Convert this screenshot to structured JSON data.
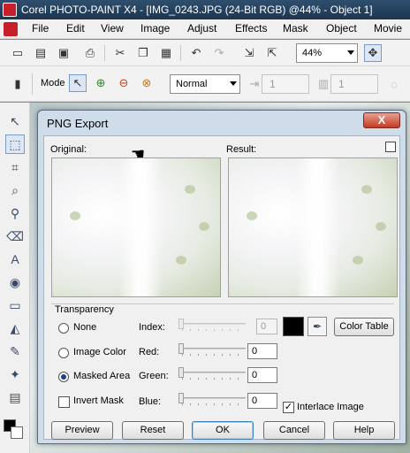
{
  "window": {
    "title": "Corel PHOTO-PAINT X4 - [IMG_0243.JPG (24-Bit RGB) @44% - Object 1]"
  },
  "menu": {
    "items": [
      "File",
      "Edit",
      "View",
      "Image",
      "Adjust",
      "Effects",
      "Mask",
      "Object",
      "Movie"
    ]
  },
  "toolbar": {
    "zoom_value": "44%"
  },
  "property_bar": {
    "mode_label": "Mode",
    "merge_mode_value": "Normal",
    "spin1_value": "1",
    "spin2_value": "1"
  },
  "dialog": {
    "title": "PNG Export",
    "close_label": "X",
    "original_label": "Original:",
    "result_label": "Result:",
    "transparency_label": "Transparency",
    "options": {
      "none": "None",
      "image_color": "Image Color",
      "masked_area": "Masked Area",
      "invert_mask": "Invert Mask",
      "selected": "masked_area"
    },
    "fields": {
      "index_label": "Index:",
      "index_value": "0",
      "red_label": "Red:",
      "red_value": "0",
      "green_label": "Green:",
      "green_value": "0",
      "blue_label": "Blue:",
      "blue_value": "0"
    },
    "color_table_button": "Color Table",
    "interlace_label": "Interlace Image",
    "interlace_checked": true,
    "invert_mask_checked": false,
    "swatch_color": "#000000",
    "buttons": {
      "preview": "Preview",
      "reset": "Reset",
      "ok": "OK",
      "cancel": "Cancel",
      "help": "Help"
    }
  }
}
